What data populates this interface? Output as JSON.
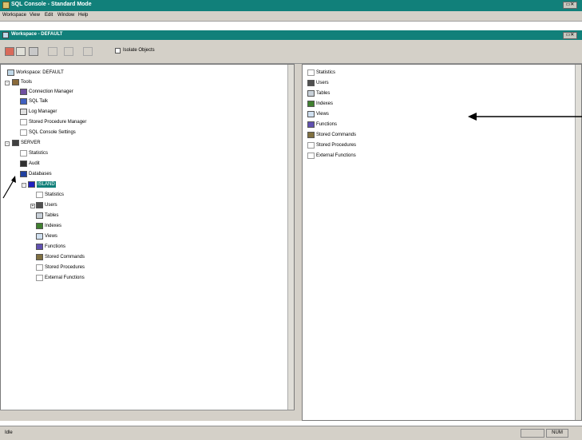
{
  "app": {
    "title": "SQL Console - Standard Mode"
  },
  "menu": {
    "items": [
      "Workspace",
      "View",
      "Edit",
      "Window",
      "Help"
    ]
  },
  "workspace_window": {
    "title": "Workspace - DEFAULT"
  },
  "toolbar": {
    "isolate_label": "Isolate Objects"
  },
  "left_tree": {
    "root": "Workspace: DEFAULT",
    "tools": {
      "label": "Tools",
      "children": [
        "Connection Manager",
        "SQL Talk",
        "Log Manager",
        "Stored Procedure Manager",
        "SQL Console Settings"
      ]
    },
    "server": {
      "label": "SERVER",
      "children": [
        "Statistics",
        "Audit",
        "Databases"
      ],
      "database": {
        "label": "ISLAND",
        "children": [
          "Statistics",
          "Users",
          "Tables",
          "Indexes",
          "Views",
          "Functions",
          "Stored Commands",
          "Stored Procedures",
          "External Functions"
        ]
      }
    }
  },
  "right_list": {
    "items": [
      "Statistics",
      "Users",
      "Tables",
      "Indexes",
      "Views",
      "Functions",
      "Stored Commands",
      "Stored Procedures",
      "External Functions"
    ]
  },
  "status": {
    "text": "Idle",
    "right_cell": "NUM"
  },
  "colors": {
    "title_bar": "#11807a",
    "chrome": "#d4d0c8",
    "selection": "#11807a"
  },
  "icons": [
    "app-icon",
    "workspace-icon",
    "connection-icon",
    "table-icon",
    "user-icon",
    "index-icon",
    "view-icon",
    "function-icon",
    "command-icon",
    "procedure-icon",
    "statistics-icon",
    "server-icon",
    "database-icon"
  ]
}
